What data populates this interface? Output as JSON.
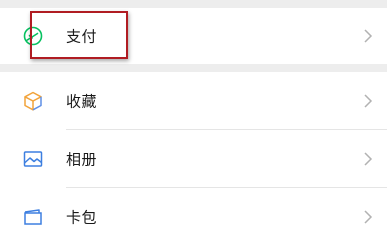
{
  "menu": {
    "pay": {
      "label": "支付",
      "icon": "pay-icon",
      "icon_color": "#07c160"
    },
    "items": [
      {
        "label": "收藏",
        "icon": "favorites-cube-icon",
        "icon_colors": [
          "#f2a33a",
          "#5f8fe6"
        ]
      },
      {
        "label": "相册",
        "icon": "album-picture-icon",
        "icon_color": "#3d7fe0"
      },
      {
        "label": "卡包",
        "icon": "card-wallet-icon",
        "icon_color": "#3d7fe0"
      }
    ]
  },
  "highlight": {
    "color": "#b01c22",
    "target": "pay"
  }
}
